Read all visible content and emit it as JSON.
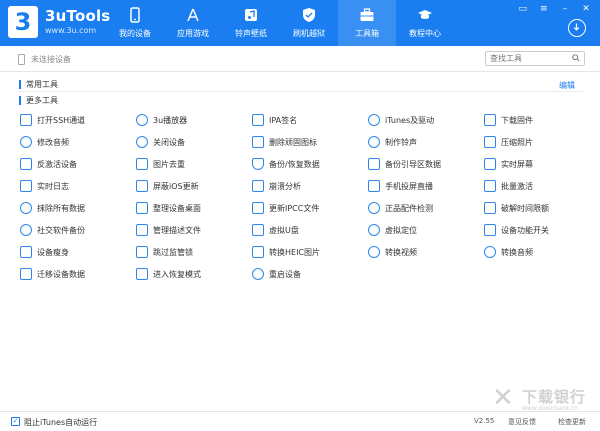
{
  "app": {
    "name": "3uTools",
    "url": "www.3u.com",
    "logo_glyph": "3"
  },
  "nav": [
    {
      "label": "我的设备",
      "icon": "phone-icon"
    },
    {
      "label": "应用游戏",
      "icon": "app-store-icon"
    },
    {
      "label": "铃声壁纸",
      "icon": "music-icon"
    },
    {
      "label": "刷机越狱",
      "icon": "shield-icon"
    },
    {
      "label": "工具箱",
      "icon": "toolbox-icon",
      "active": true
    },
    {
      "label": "教程中心",
      "icon": "graduation-cap-icon"
    }
  ],
  "window_controls": {
    "skin": "▭",
    "menu": "≡",
    "minimize": "–",
    "close": "✕"
  },
  "device_status": "未连接设备",
  "search_placeholder": "查找工具",
  "sections": {
    "common": "常用工具",
    "edit": "编辑",
    "more": "更多工具"
  },
  "tools": [
    [
      "打开SSH通道",
      "3u播放器",
      "IPA签名",
      "iTunes及驱动",
      "下载固件"
    ],
    [
      "修改音频",
      "关闭设备",
      "删除顽固图标",
      "制作铃声",
      "压缩照片"
    ],
    [
      "反激活设备",
      "图片去重",
      "备份/恢复数据",
      "备份引导区数据",
      "实时屏幕"
    ],
    [
      "实时日志",
      "屏蔽iOS更新",
      "崩溃分析",
      "手机投屏直播",
      "批量激活"
    ],
    [
      "抹除所有数据",
      "整理设备桌面",
      "更新IPCC文件",
      "正品配件检测",
      "破解时间限额"
    ],
    [
      "社交软件备份",
      "管理描述文件",
      "虚拟U盘",
      "虚拟定位",
      "设备功能开关"
    ],
    [
      "设备瘦身",
      "跳过监管锁",
      "转换HEIC图片",
      "转换视频",
      "转换音频"
    ],
    [
      "迁移设备数据",
      "进入恢复模式",
      "重启设备"
    ]
  ],
  "bottom": {
    "checkbox_label": "阻止iTunes自动运行",
    "checked": true,
    "version": "V2.55",
    "feedback": "意见反馈",
    "update": "检查更新"
  },
  "watermark": {
    "title": "下载银行",
    "url": "www.downbank.cn"
  },
  "colors": {
    "accent": "#1a7ef0",
    "active_tab": "#3a8ff3"
  }
}
